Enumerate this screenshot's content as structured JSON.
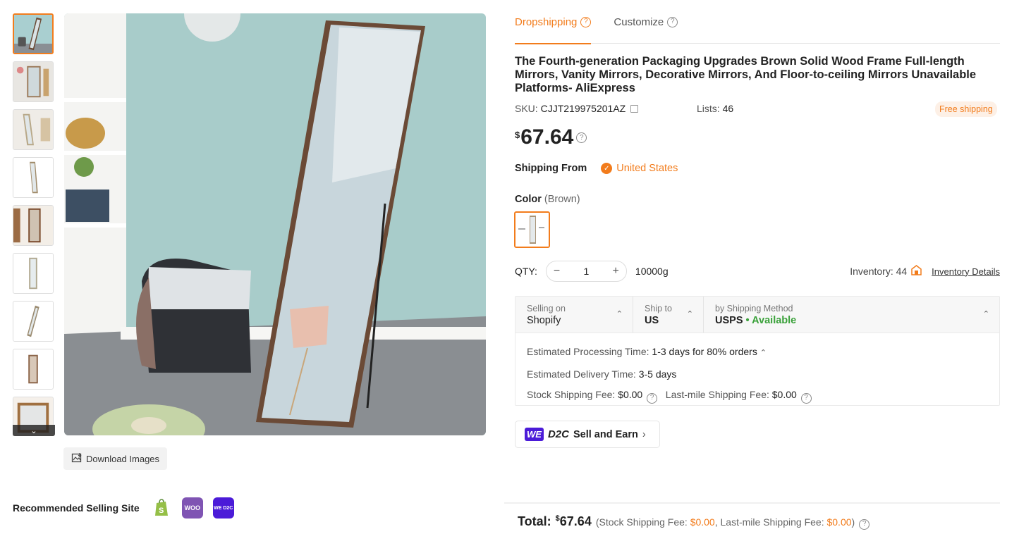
{
  "tabs": [
    {
      "label": "Dropshipping"
    },
    {
      "label": "Customize"
    }
  ],
  "product": {
    "title": "The Fourth-generation Packaging Upgrades Brown Solid Wood Frame Full-length Mirrors, Vanity Mirrors, Decorative Mirrors, And Floor-to-ceiling Mirrors Unavailable Platforms- AliExpress",
    "sku_label": "SKU:",
    "sku": "CJJT219975201AZ",
    "lists_label": "Lists:",
    "lists": "46",
    "free_shipping": "Free shipping",
    "currency": "$",
    "price": "67.64"
  },
  "shipping_from": {
    "label": "Shipping From",
    "value": "United States"
  },
  "color": {
    "label": "Color",
    "selected": "(Brown)"
  },
  "qty": {
    "label": "QTY:",
    "value": "1",
    "minus": "−",
    "plus": "+",
    "weight": "10000g"
  },
  "inventory": {
    "label": "Inventory: 44",
    "link": "Inventory Details"
  },
  "shipping_box": {
    "selling_on_label": "Selling on",
    "selling_on": "Shopify",
    "ship_to_label": "Ship to",
    "ship_to": "US",
    "method_label": "by Shipping Method",
    "method": "USPS",
    "status": "• Available",
    "processing_label": "Estimated Processing Time:",
    "processing": "1-3 days for 80% orders",
    "delivery_label": "Estimated Delivery Time:",
    "delivery": "3-5 days",
    "stock_fee_label": "Stock Shipping Fee:",
    "stock_fee": "$0.00",
    "lastmile_label": "Last-mile Shipping Fee:",
    "lastmile_fee": "$0.00"
  },
  "wed2c": {
    "we": "WE",
    "d2c": "D2C",
    "label": "Sell and Earn"
  },
  "download": "Download Images",
  "recommended": {
    "label": "Recommended Selling Site",
    "sites": [
      "shopify-icon",
      "woocommerce-icon",
      "wed2c-icon"
    ],
    "woo": "WOO",
    "wed2c": "WE D2C"
  },
  "total": {
    "label": "Total:",
    "currency": "$",
    "value": "67.64",
    "open": "(Stock Shipping Fee:",
    "stock": "$0.00",
    "mid": ", Last-mile Shipping Fee:",
    "lastmile": "$0.00",
    "close": ")"
  },
  "colors": {
    "accent": "#f27c1c",
    "available": "#3aa13a",
    "we_purple": "#4b1bd8"
  }
}
